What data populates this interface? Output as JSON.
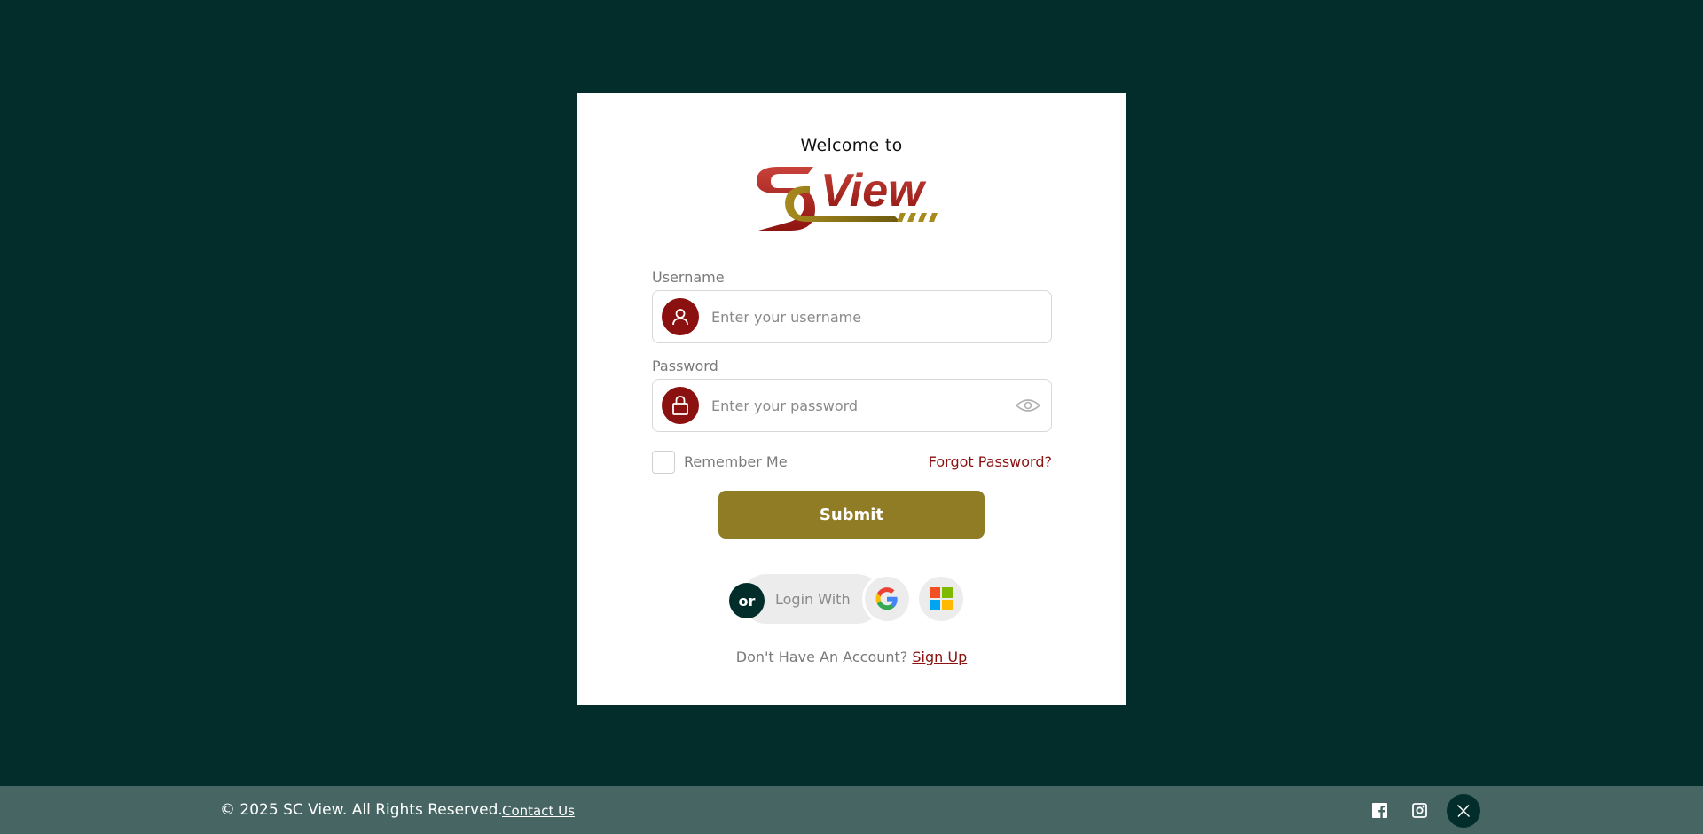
{
  "login": {
    "welcome": "Welcome to",
    "brand": "SCView",
    "username_label": "Username",
    "username_placeholder": "Enter your username",
    "password_label": "Password",
    "password_placeholder": "Enter your password",
    "remember_label": "Remember Me",
    "forgot_label": "Forgot Password?",
    "submit_label": "Submit",
    "or_label": "or",
    "login_with_label": "Login With",
    "no_account_label": "Don't Have An Account?",
    "signup_label": "Sign Up"
  },
  "footer": {
    "copyright": "© 2025 SC View. All Rights Reserved.",
    "contact_label": "Contact Us",
    "social": [
      "facebook-icon",
      "instagram-icon",
      "x-icon"
    ]
  },
  "colors": {
    "background": "#022d2b",
    "accent_red": "#8b1010",
    "submit_gold": "#917c26",
    "footer": "#476663"
  }
}
